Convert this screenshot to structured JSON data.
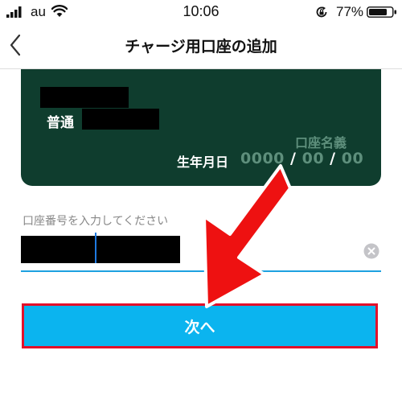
{
  "status_bar": {
    "carrier": "au",
    "time": "10:06",
    "battery_percent": "77%",
    "icons": [
      "signal-bars-icon",
      "wifi-icon",
      "rotation-lock-icon",
      "battery-icon"
    ]
  },
  "nav": {
    "title": "チャージ用口座の追加",
    "back_icon": "chevron-left-icon"
  },
  "card": {
    "account_type": "普通",
    "holder_label": "口座名義",
    "birth_label": "生年月日",
    "birth_year": "0000",
    "birth_month": "00",
    "birth_day": "00",
    "date_separator": "/"
  },
  "form": {
    "account_number_label": "口座番号を入力してください",
    "clear_icon": "clear-x-icon"
  },
  "actions": {
    "next_label": "次へ"
  },
  "colors": {
    "card_background": "#0f3d2e",
    "primary_button": "#0bb4ef",
    "highlight_border": "#e3102a",
    "annotation_arrow": "#ee1111",
    "input_underline": "#1ea1e0"
  }
}
